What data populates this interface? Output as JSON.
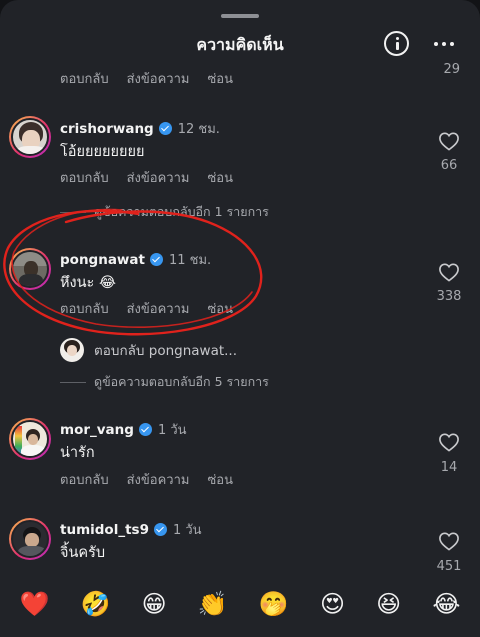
{
  "header": {
    "title": "ความคิดเห็น"
  },
  "actions": {
    "reply": "ตอบกลับ",
    "send": "ส่งข้อความ",
    "hide": "ซ่อน"
  },
  "top_partial_count": "29",
  "comments": [
    {
      "username": "crishorwang",
      "time": "12 ชม.",
      "text": "โอ้ยยยยยยยย",
      "likes": "66",
      "view_replies": "ดูข้อความตอบกลับอีก 1 รายการ"
    },
    {
      "username": "pongnawat",
      "time": "11 ชม.",
      "text": "หึงนะ 😂",
      "likes": "338",
      "reply_preview": "ตอบกลับ pongnawat...",
      "view_replies": "ดูข้อความตอบกลับอีก 5 รายการ"
    },
    {
      "username": "mor_vang",
      "time": "1 วัน",
      "text": "น่ารัก",
      "likes": "14"
    },
    {
      "username": "tumidol_ts9",
      "time": "1 วัน",
      "text": "จิ้นครับ",
      "likes": "451"
    }
  ],
  "emojis": [
    "❤️",
    "🤣",
    "😁",
    "👏",
    "🤭",
    "😍",
    "😆",
    "😂"
  ],
  "colors": {
    "background": "#212328",
    "verified": "#3796f0",
    "annotation": "#e0221c"
  },
  "icons": {
    "info": "info-circle-icon",
    "more": "more-horizontal-icon",
    "like": "heart-outline-icon",
    "verified": "verified-badge-icon"
  }
}
